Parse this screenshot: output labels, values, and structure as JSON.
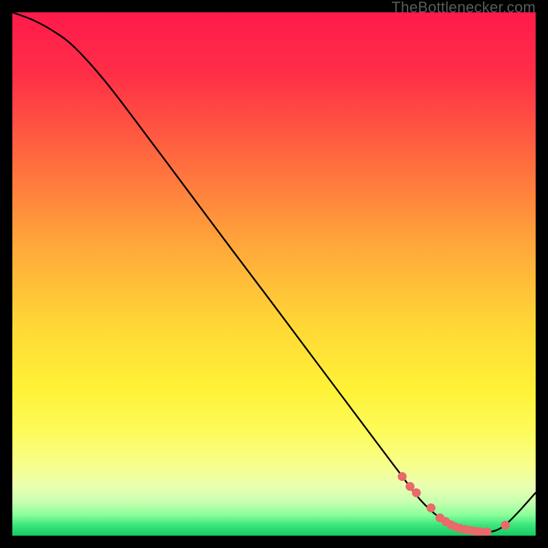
{
  "watermark": "TheBottlenecker.com",
  "colors": {
    "gradient_stops": [
      {
        "offset": 0.0,
        "color": "#ff1a4b"
      },
      {
        "offset": 0.12,
        "color": "#ff2f47"
      },
      {
        "offset": 0.28,
        "color": "#ff6a3f"
      },
      {
        "offset": 0.45,
        "color": "#ffa93a"
      },
      {
        "offset": 0.6,
        "color": "#ffd836"
      },
      {
        "offset": 0.72,
        "color": "#fff236"
      },
      {
        "offset": 0.8,
        "color": "#fdfb5a"
      },
      {
        "offset": 0.86,
        "color": "#f8ff88"
      },
      {
        "offset": 0.905,
        "color": "#eaffb0"
      },
      {
        "offset": 0.935,
        "color": "#c8ffb0"
      },
      {
        "offset": 0.96,
        "color": "#8bff9a"
      },
      {
        "offset": 0.98,
        "color": "#39e67c"
      },
      {
        "offset": 1.0,
        "color": "#17c95f"
      }
    ],
    "curve": "#000000",
    "marker_fill": "#e86a6a",
    "marker_stroke": "#d35454"
  },
  "chart_data": {
    "type": "line",
    "title": "",
    "xlabel": "",
    "ylabel": "",
    "xlim": [
      0,
      100
    ],
    "ylim": [
      0,
      100
    ],
    "series": [
      {
        "name": "bottleneck-curve",
        "x": [
          0,
          4,
          8,
          12,
          18,
          26,
          34,
          42,
          50,
          58,
          64,
          70,
          74,
          78,
          82,
          86,
          88,
          90,
          94,
          100
        ],
        "y": [
          100,
          98.5,
          96.3,
          93.2,
          86.5,
          76,
          65.3,
          54.6,
          44,
          33.3,
          25.3,
          17.3,
          12,
          6.8,
          3.2,
          1.3,
          0.8,
          0.6,
          1.9,
          8.2
        ]
      }
    ],
    "markers": [
      {
        "name": "highlight-dots",
        "x": [
          74.5,
          76,
          77.2,
          80,
          81.7,
          82.8,
          83.8,
          84.6,
          85.5,
          86.5,
          87.6,
          88.6,
          89.5,
          90.7,
          94.2
        ],
        "y": [
          11.3,
          9.4,
          8.2,
          5.3,
          3.4,
          2.7,
          2.1,
          1.7,
          1.4,
          1.2,
          1.0,
          0.85,
          0.75,
          0.7,
          2.0
        ]
      }
    ]
  }
}
